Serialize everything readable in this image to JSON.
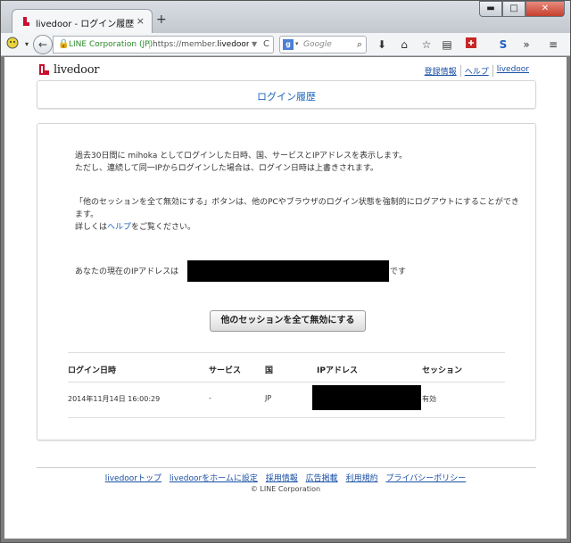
{
  "browser": {
    "tab_title": "livedoor - ログイン履歴",
    "tab_close": "×",
    "new_tab": "+",
    "win_min": "▬",
    "win_max": "□",
    "win_close": "✕",
    "back": "←",
    "site_org": "LINE Corporation (JP)",
    "url_prefix": "https://member.",
    "url_domain": "livedoor.c",
    "search_placeholder": "Google",
    "search_engine_letter": "g"
  },
  "header": {
    "logo_text": "livedoor",
    "links": [
      "登録情報",
      "ヘルプ",
      "livedoor"
    ]
  },
  "page": {
    "title": "ログイン履歴",
    "intro_line1": "過去30日間に mihoka としてログインした日時、国、サービスとIPアドレスを表示します。",
    "intro_line2": "ただし、連続して同一IPからログインした場合は、ログイン日時は上書きされます。",
    "desc_line1": "「他のセッションを全て無効にする」ボタンは、他のPCやブラウザのログイン状態を強制的にログアウトにすることができ",
    "desc_line2": "ます。",
    "help_prefix": "詳しくは",
    "help_link": "ヘルプ",
    "help_suffix": "をご覧ください。",
    "ip_prefix": "あなたの現在のIPアドレスは",
    "ip_suffix": "です",
    "invalidate_button": "他のセッションを全て無効にする"
  },
  "table": {
    "headers": [
      "ログイン日時",
      "サービス",
      "国",
      "IPアドレス",
      "セッション"
    ],
    "rows": [
      {
        "datetime": "2014年11月14日 16:00:29",
        "service": "-",
        "country": "JP",
        "session": "有効"
      }
    ]
  },
  "footer": {
    "links": [
      "livedoorトップ",
      "livedoorをホームに設定",
      "採用情報",
      "広告掲載",
      "利用規約",
      "プライバシーポリシー"
    ],
    "copyright": "© LINE Corporation"
  }
}
